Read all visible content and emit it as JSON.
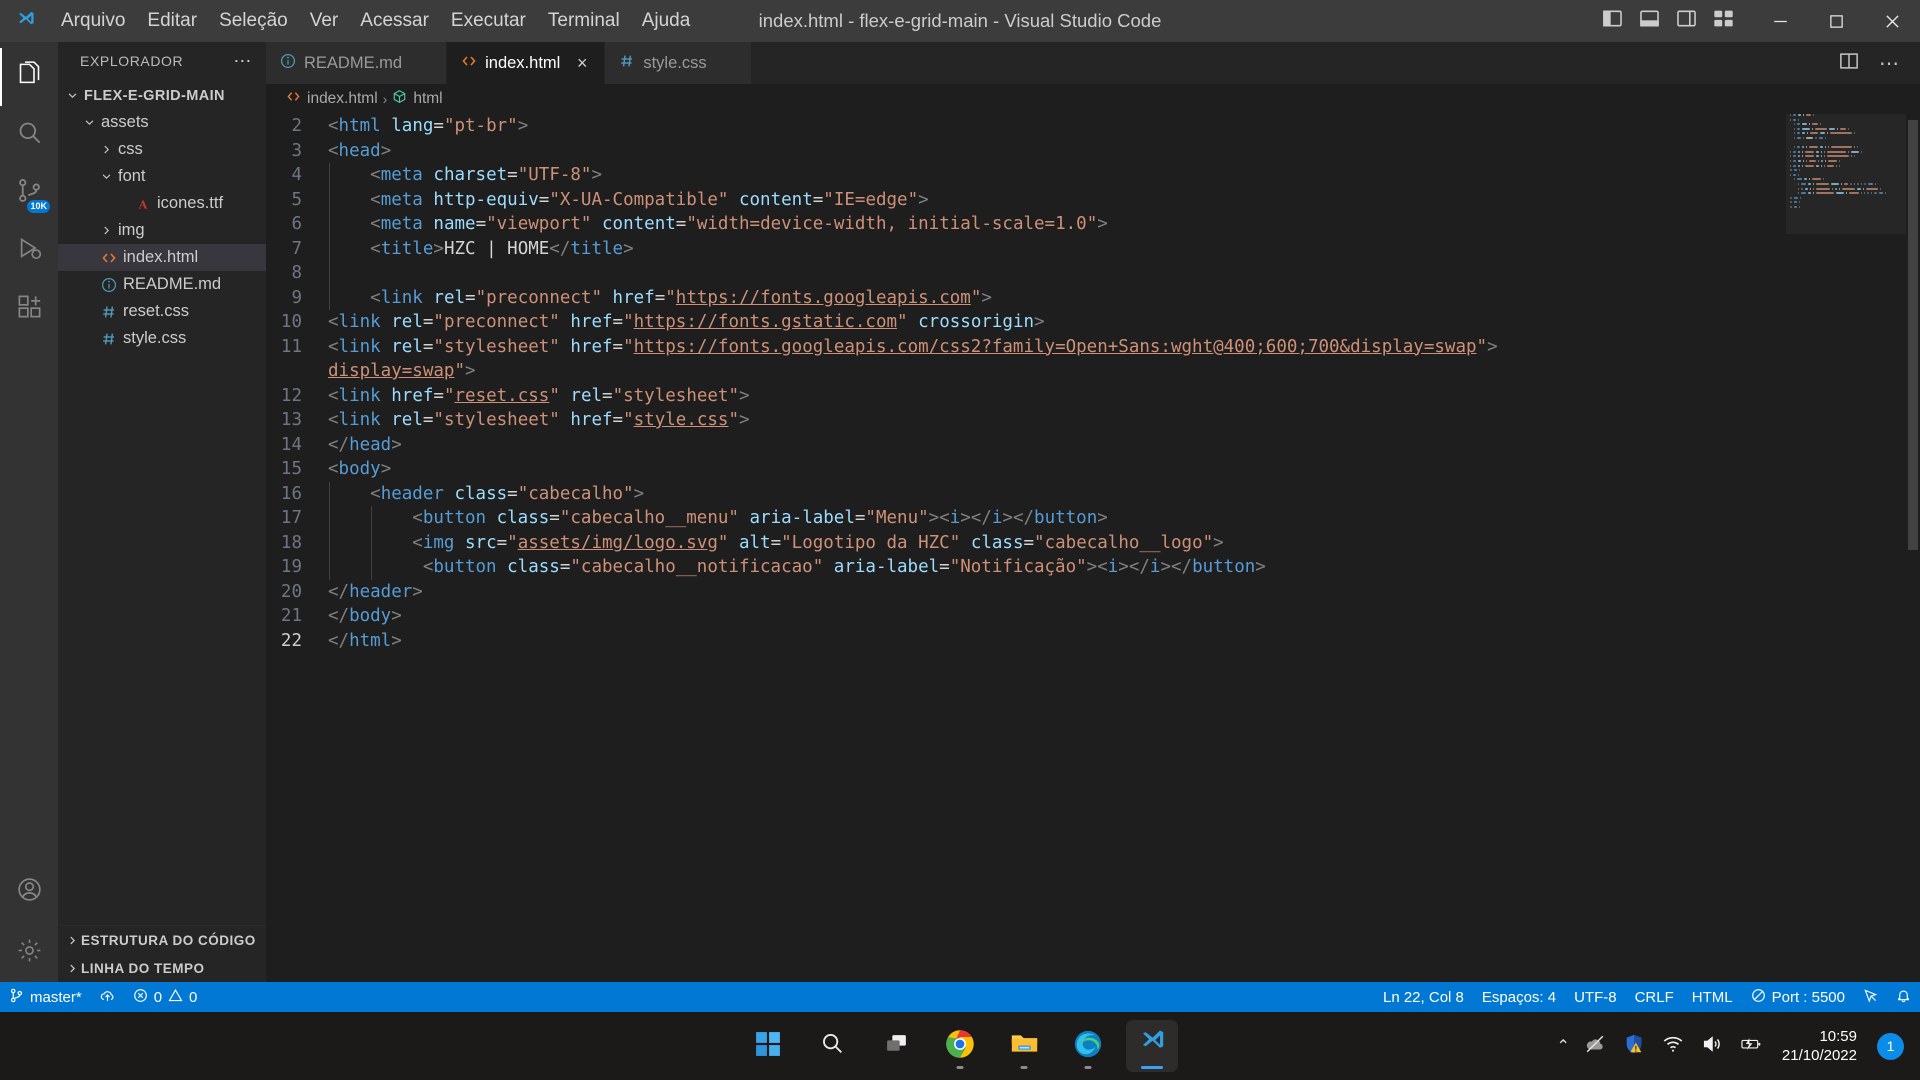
{
  "window": {
    "title": "index.html - flex-e-grid-main - Visual Studio Code",
    "logo_icon": "vscode-logo",
    "minimize_icon": "minimize-icon",
    "maximize_icon": "maximize-icon",
    "close_icon": "close-icon",
    "layout_icons": [
      "toggle-primary-sidebar-icon",
      "toggle-panel-icon",
      "toggle-secondary-sidebar-icon",
      "customize-layout-icon"
    ]
  },
  "menubar": {
    "items": [
      {
        "label": "Arquivo"
      },
      {
        "label": "Editar"
      },
      {
        "label": "Seleção"
      },
      {
        "label": "Ver"
      },
      {
        "label": "Acessar"
      },
      {
        "label": "Executar"
      },
      {
        "label": "Terminal"
      },
      {
        "label": "Ajuda"
      }
    ]
  },
  "activitybar": {
    "items": [
      {
        "name": "explorer",
        "icon": "files-icon",
        "active": true,
        "badge": ""
      },
      {
        "name": "search",
        "icon": "search-icon",
        "active": false,
        "badge": ""
      },
      {
        "name": "source-control",
        "icon": "source-control-icon",
        "active": false,
        "badge": "10K"
      },
      {
        "name": "run-and-debug",
        "icon": "run-debug-icon",
        "active": false,
        "badge": ""
      },
      {
        "name": "extensions",
        "icon": "extensions-icon",
        "active": false,
        "badge": ""
      }
    ],
    "bottom": [
      {
        "name": "accounts",
        "icon": "account-icon"
      },
      {
        "name": "manage",
        "icon": "gear-icon"
      }
    ]
  },
  "sidebar": {
    "title": "EXPLORADOR",
    "more_actions": "⋯",
    "tree": [
      {
        "label": "FLEX-E-GRID-MAIN",
        "indent": 0,
        "chevron": "down",
        "icon": "",
        "kind": "root",
        "selected": false
      },
      {
        "label": "assets",
        "indent": 1,
        "chevron": "down",
        "icon": "",
        "kind": "folder",
        "selected": false
      },
      {
        "label": "css",
        "indent": 2,
        "chevron": "right",
        "icon": "",
        "kind": "folder",
        "selected": false
      },
      {
        "label": "font",
        "indent": 2,
        "chevron": "down",
        "icon": "",
        "kind": "folder",
        "selected": false
      },
      {
        "label": "icones.ttf",
        "indent": 3,
        "chevron": "none",
        "icon": "font-file-icon",
        "kind": "file",
        "selected": false
      },
      {
        "label": "img",
        "indent": 2,
        "chevron": "right",
        "icon": "",
        "kind": "folder",
        "selected": false
      },
      {
        "label": "index.html",
        "indent": 1,
        "chevron": "none",
        "icon": "html-file-icon",
        "kind": "file",
        "selected": true
      },
      {
        "label": "README.md",
        "indent": 1,
        "chevron": "none",
        "icon": "markdown-file-icon",
        "kind": "file",
        "selected": false
      },
      {
        "label": "reset.css",
        "indent": 1,
        "chevron": "none",
        "icon": "css-file-icon",
        "kind": "file",
        "selected": false
      },
      {
        "label": "style.css",
        "indent": 1,
        "chevron": "none",
        "icon": "css-file-icon",
        "kind": "file",
        "selected": false
      }
    ],
    "sections": [
      {
        "label": "ESTRUTURA DO CÓDIGO",
        "chevron": "right"
      },
      {
        "label": "LINHA DO TEMPO",
        "chevron": "right"
      }
    ]
  },
  "tabs": [
    {
      "label": "README.md",
      "icon": "markdown-file-icon",
      "active": false,
      "close": "×"
    },
    {
      "label": "index.html",
      "icon": "html-file-icon",
      "active": true,
      "close": "×"
    },
    {
      "label": "style.css",
      "icon": "css-file-icon",
      "active": false,
      "close": "×"
    }
  ],
  "tab_actions": {
    "split_editor_icon": "split-editor-icon",
    "more_icon": "⋯"
  },
  "breadcrumb": {
    "file": "index.html",
    "file_icon": "html-file-icon",
    "separator": "›",
    "symbol": "html",
    "symbol_icon": "symbol-icon"
  },
  "editor": {
    "lines": [
      {
        "num": "2",
        "html": "<span class=\"t-brk\">&lt;</span><span class=\"t-tag\">html</span> <span class=\"t-attr\">lang</span><span class=\"t-eq\">=</span><span class=\"t-str\">\"pt-br\"</span><span class=\"t-brk\">&gt;</span>",
        "indent": 0
      },
      {
        "num": "3",
        "html": "<span class=\"t-brk\">&lt;</span><span class=\"t-tag\">head</span><span class=\"t-brk\">&gt;</span>",
        "indent": 0
      },
      {
        "num": "4",
        "html": "    <span class=\"t-brk\">&lt;</span><span class=\"t-tag\">meta</span> <span class=\"t-attr\">charset</span><span class=\"t-eq\">=</span><span class=\"t-str\">\"UTF-8\"</span><span class=\"t-brk\">&gt;</span>",
        "indent": 1
      },
      {
        "num": "5",
        "html": "    <span class=\"t-brk\">&lt;</span><span class=\"t-tag\">meta</span> <span class=\"t-attr\">http-equiv</span><span class=\"t-eq\">=</span><span class=\"t-str\">\"X-UA-Compatible\"</span> <span class=\"t-attr\">content</span><span class=\"t-eq\">=</span><span class=\"t-str\">\"IE=edge\"</span><span class=\"t-brk\">&gt;</span>",
        "indent": 1
      },
      {
        "num": "6",
        "html": "    <span class=\"t-brk\">&lt;</span><span class=\"t-tag\">meta</span> <span class=\"t-attr\">name</span><span class=\"t-eq\">=</span><span class=\"t-str\">\"viewport\"</span> <span class=\"t-attr\">content</span><span class=\"t-eq\">=</span><span class=\"t-str\">\"width=device-width, initial-scale=1.0\"</span><span class=\"t-brk\">&gt;</span>",
        "indent": 1
      },
      {
        "num": "7",
        "html": "    <span class=\"t-brk\">&lt;</span><span class=\"t-tag\">title</span><span class=\"t-brk\">&gt;</span><span class=\"t-txt\">HZC | HOME</span><span class=\"t-brk\">&lt;/</span><span class=\"t-tag\">title</span><span class=\"t-brk\">&gt;</span>",
        "indent": 1
      },
      {
        "num": "8",
        "html": "",
        "indent": 1
      },
      {
        "num": "9",
        "html": "    <span class=\"t-brk\">&lt;</span><span class=\"t-tag\">link</span> <span class=\"t-attr\">rel</span><span class=\"t-eq\">=</span><span class=\"t-str\">\"preconnect\"</span> <span class=\"t-attr\">href</span><span class=\"t-eq\">=</span><span class=\"t-str\">\"</span><span class=\"t-link\">https://fonts.googleapis.com</span><span class=\"t-str\">\"</span><span class=\"t-brk\">&gt;</span>",
        "indent": 1
      },
      {
        "num": "10",
        "html": "<span class=\"t-brk\">&lt;</span><span class=\"t-tag\">link</span> <span class=\"t-attr\">rel</span><span class=\"t-eq\">=</span><span class=\"t-str\">\"preconnect\"</span> <span class=\"t-attr\">href</span><span class=\"t-eq\">=</span><span class=\"t-str\">\"</span><span class=\"t-link\">https://fonts.gstatic.com</span><span class=\"t-str\">\"</span> <span class=\"t-attr\">crossorigin</span><span class=\"t-brk\">&gt;</span>",
        "indent": 0
      },
      {
        "num": "11",
        "html": "<span class=\"t-brk\">&lt;</span><span class=\"t-tag\">link</span> <span class=\"t-attr\">rel</span><span class=\"t-eq\">=</span><span class=\"t-str\">\"stylesheet\"</span> <span class=\"t-attr\">href</span><span class=\"t-eq\">=</span><span class=\"t-str\">\"</span><span class=\"t-link\">https://fonts.googleapis.com/css2?family=Open+Sans:wght@400;600;700&amp;display=swap</span><span class=\"t-str\">\"</span><span class=\"t-brk\">&gt;</span>",
        "indent": 0,
        "wrap": true
      },
      {
        "num": "12",
        "html": "<span class=\"t-brk\">&lt;</span><span class=\"t-tag\">link</span> <span class=\"t-attr\">href</span><span class=\"t-eq\">=</span><span class=\"t-str\">\"</span><span class=\"t-link\">reset.css</span><span class=\"t-str\">\"</span> <span class=\"t-attr\">rel</span><span class=\"t-eq\">=</span><span class=\"t-str\">\"stylesheet\"</span><span class=\"t-brk\">&gt;</span>",
        "indent": 0
      },
      {
        "num": "13",
        "html": "<span class=\"t-brk\">&lt;</span><span class=\"t-tag\">link</span> <span class=\"t-attr\">rel</span><span class=\"t-eq\">=</span><span class=\"t-str\">\"stylesheet\"</span> <span class=\"t-attr\">href</span><span class=\"t-eq\">=</span><span class=\"t-str\">\"</span><span class=\"t-link\">style.css</span><span class=\"t-str\">\"</span><span class=\"t-brk\">&gt;</span>",
        "indent": 0
      },
      {
        "num": "14",
        "html": "<span class=\"t-brk\">&lt;/</span><span class=\"t-tag\">head</span><span class=\"t-brk\">&gt;</span>",
        "indent": 0
      },
      {
        "num": "15",
        "html": "<span class=\"t-brk\">&lt;</span><span class=\"t-tag\">body</span><span class=\"t-brk\">&gt;</span>",
        "indent": 0
      },
      {
        "num": "16",
        "html": "    <span class=\"t-brk\">&lt;</span><span class=\"t-tag\">header</span> <span class=\"t-attr\">class</span><span class=\"t-eq\">=</span><span class=\"t-str\">\"cabecalho\"</span><span class=\"t-brk\">&gt;</span>",
        "indent": 1
      },
      {
        "num": "17",
        "html": "        <span class=\"t-brk\">&lt;</span><span class=\"t-tag\">button</span> <span class=\"t-attr\">class</span><span class=\"t-eq\">=</span><span class=\"t-str\">\"cabecalho__menu\"</span> <span class=\"t-attr\">aria-label</span><span class=\"t-eq\">=</span><span class=\"t-str\">\"Menu\"</span><span class=\"t-brk\">&gt;&lt;</span><span class=\"t-tag\">i</span><span class=\"t-brk\">&gt;&lt;/</span><span class=\"t-tag\">i</span><span class=\"t-brk\">&gt;&lt;/</span><span class=\"t-tag\">button</span><span class=\"t-brk\">&gt;</span>",
        "indent": 2
      },
      {
        "num": "18",
        "html": "        <span class=\"t-brk\">&lt;</span><span class=\"t-tag\">img</span> <span class=\"t-attr\">src</span><span class=\"t-eq\">=</span><span class=\"t-str\">\"</span><span class=\"t-link\">assets/img/logo.svg</span><span class=\"t-str\">\"</span> <span class=\"t-attr\">alt</span><span class=\"t-eq\">=</span><span class=\"t-str\">\"Logotipo da HZC\"</span> <span class=\"t-attr\">class</span><span class=\"t-eq\">=</span><span class=\"t-str\">\"cabecalho__logo\"</span><span class=\"t-brk\">&gt;</span>",
        "indent": 2
      },
      {
        "num": "19",
        "html": "         <span class=\"t-brk\">&lt;</span><span class=\"t-tag\">button</span> <span class=\"t-attr\">class</span><span class=\"t-eq\">=</span><span class=\"t-str\">\"cabecalho__notificacao\"</span> <span class=\"t-attr\">aria-label</span><span class=\"t-eq\">=</span><span class=\"t-str\">\"Notificação\"</span><span class=\"t-brk\">&gt;&lt;</span><span class=\"t-tag\">i</span><span class=\"t-brk\">&gt;&lt;/</span><span class=\"t-tag\">i</span><span class=\"t-brk\">&gt;&lt;/</span><span class=\"t-tag\">button</span><span class=\"t-brk\">&gt;</span>",
        "indent": 2
      },
      {
        "num": "20",
        "html": "<span class=\"t-brk\">&lt;/</span><span class=\"t-tag\">header</span><span class=\"t-brk\">&gt;</span>",
        "indent": 0
      },
      {
        "num": "21",
        "html": "<span class=\"t-brk\">&lt;/</span><span class=\"t-tag\">body</span><span class=\"t-brk\">&gt;</span>",
        "indent": 0
      },
      {
        "num": "22",
        "html": "<span class=\"t-brk\">&lt;/</span><span class=\"t-tag\">html</span><span class=\"t-brk\">&gt;</span>",
        "indent": 0,
        "current": true
      }
    ],
    "wrapped_line_11_html": "<span class=\"t-link\">display=swap</span><span class=\"t-str\">\"</span><span class=\"t-brk\">&gt;</span>"
  },
  "statusbar": {
    "left": [
      {
        "name": "branch",
        "icon": "source-control-icon",
        "label": "master*"
      },
      {
        "name": "sync",
        "icon": "cloud-upload-icon",
        "label": ""
      },
      {
        "name": "problems",
        "icon": "error-warning-icon",
        "label": "0 ⚠ 0",
        "errors": "0",
        "warnings": "0"
      }
    ],
    "right": [
      {
        "name": "cursor-position",
        "label": "Ln 22, Col 8"
      },
      {
        "name": "indentation",
        "label": "Espaços: 4"
      },
      {
        "name": "encoding",
        "label": "UTF-8"
      },
      {
        "name": "eol",
        "label": "CRLF"
      },
      {
        "name": "language-mode",
        "label": "HTML"
      },
      {
        "name": "live-server-port",
        "label": "Port : 5500",
        "icon": "broadcast-icon"
      },
      {
        "name": "feedback",
        "label": "",
        "icon": "feedback-icon"
      },
      {
        "name": "notifications",
        "label": "",
        "icon": "bell-icon"
      }
    ]
  },
  "taskbar": {
    "items": [
      {
        "name": "start",
        "icon": "windows-start-icon",
        "running": false,
        "focused": false
      },
      {
        "name": "search",
        "icon": "search-icon",
        "running": false,
        "focused": false
      },
      {
        "name": "task-view",
        "icon": "task-view-icon",
        "running": false,
        "focused": false
      },
      {
        "name": "google-chrome",
        "icon": "chrome-icon",
        "running": true,
        "focused": false
      },
      {
        "name": "file-explorer",
        "icon": "folder-icon",
        "running": true,
        "focused": false
      },
      {
        "name": "microsoft-edge",
        "icon": "edge-icon",
        "running": true,
        "focused": false
      },
      {
        "name": "visual-studio-code",
        "icon": "vscode-icon",
        "running": true,
        "focused": true
      }
    ],
    "tray": {
      "expand": "⌃",
      "icons": [
        "onedrive-offline-icon",
        "windows-security-warning-icon",
        "wifi-icon",
        "volume-icon",
        "battery-charging-icon"
      ]
    },
    "clock": {
      "time": "10:59",
      "date": "21/10/2022"
    },
    "notification_count": "1"
  },
  "colors": {
    "accent": "#0078d4",
    "titlebar_bg": "#3c3c3c",
    "sidebar_bg": "#252526",
    "editor_bg": "#1e1e1e",
    "activitybar_bg": "#333333",
    "tag": "#569cd6",
    "attr": "#9cdcfe",
    "string": "#ce9178",
    "taskbar_bg": "#1c1a19"
  }
}
